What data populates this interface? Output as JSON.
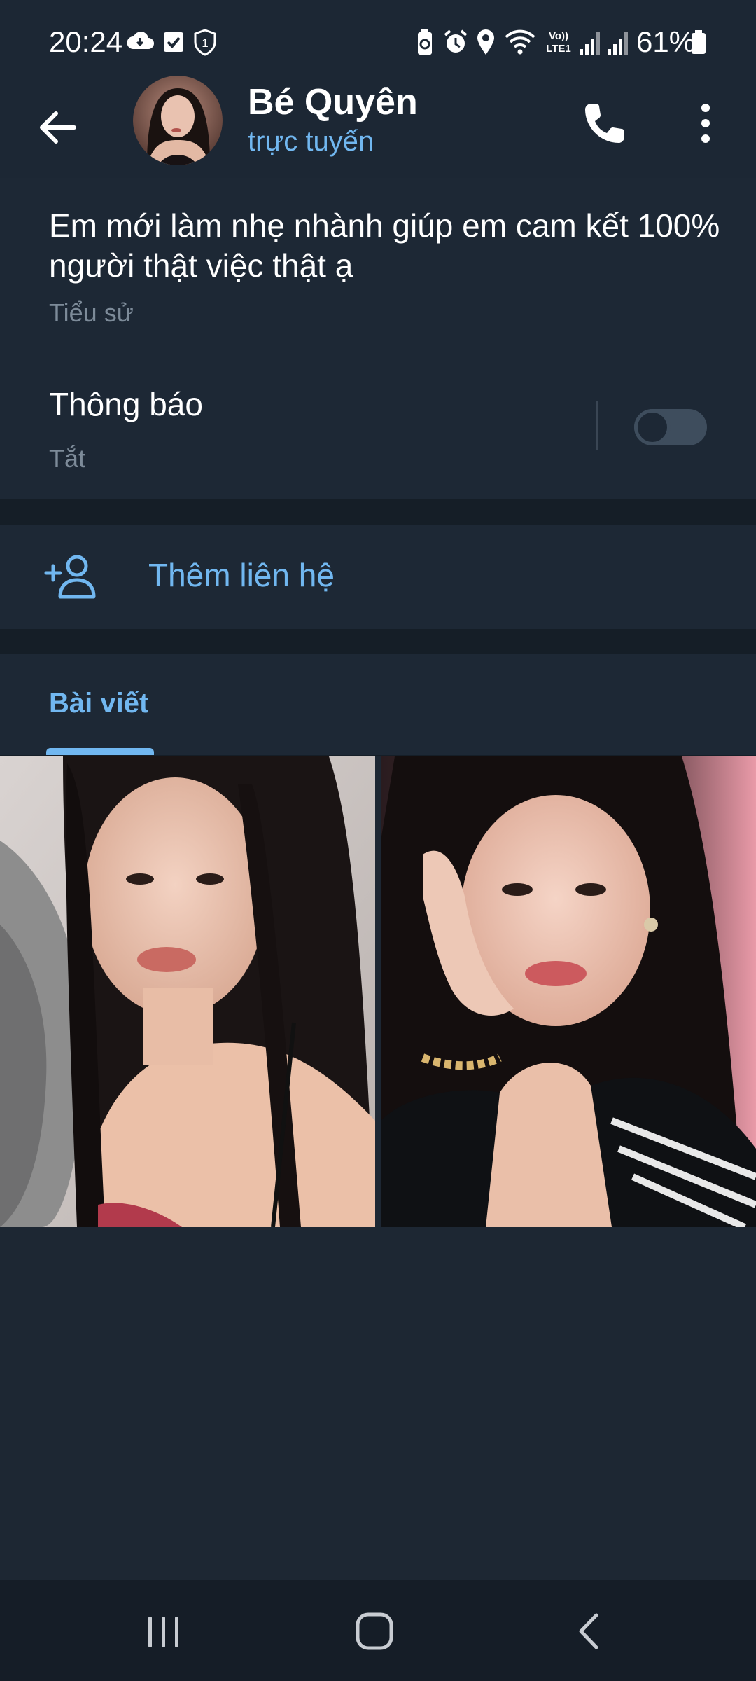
{
  "status_bar": {
    "time": "20:24",
    "battery_percent": "61%",
    "icons": [
      "cloud-sync-icon",
      "checkbox-icon",
      "shield-1-icon",
      "recycle-icon",
      "alarm-icon",
      "location-icon",
      "wifi-icon",
      "volte-lte1-icon",
      "signal-1-icon",
      "signal-2-icon",
      "battery-icon"
    ],
    "volte_label": "Vo)) LTE1",
    "shield_label": "1"
  },
  "header": {
    "name": "Bé Quyên",
    "status": "trực tuyến"
  },
  "info": {
    "bio": "Em mới làm nhẹ nhành giúp em cam kết 100% người thật việc thật ạ",
    "bio_label": "Tiểu sử",
    "notifications_title": "Thông báo",
    "notifications_value": "Tắt",
    "notifications_on": false
  },
  "actions": {
    "add_contact": "Thêm liên hệ"
  },
  "tabs": {
    "posts": "Bài viết"
  },
  "posts": [
    {
      "kind": "photo",
      "description": "selfie"
    },
    {
      "kind": "photo",
      "description": "selfie"
    }
  ],
  "colors": {
    "accent": "#71b7f0",
    "background": "#1d2835",
    "divider": "#151e27"
  }
}
